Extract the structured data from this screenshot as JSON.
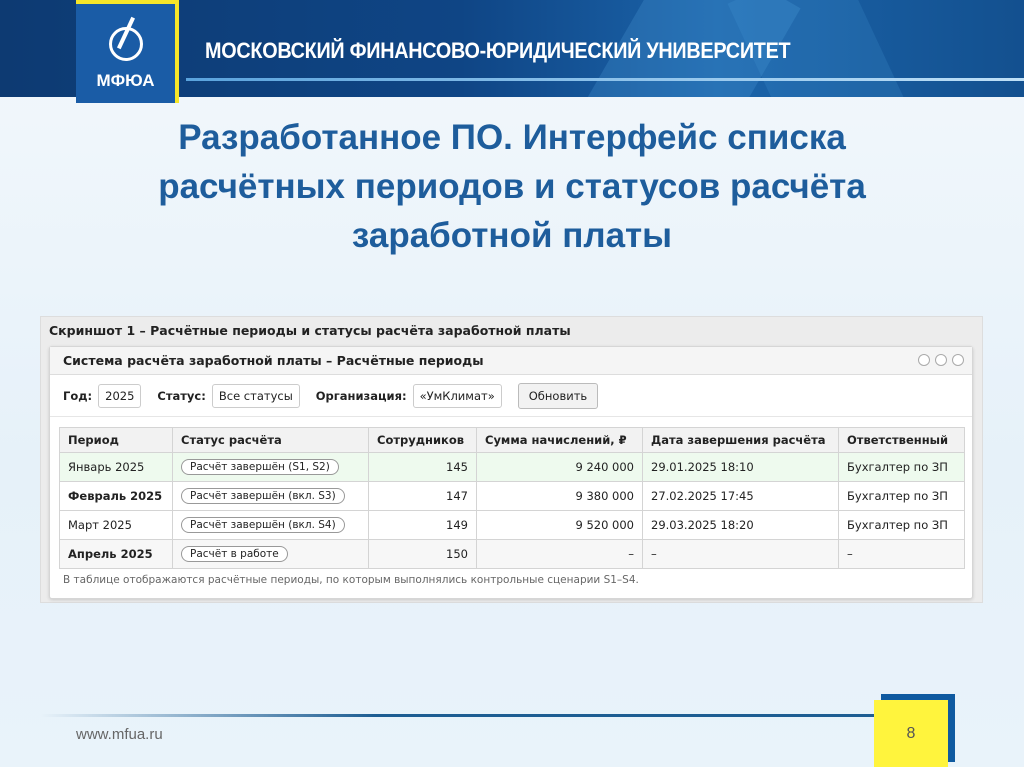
{
  "header": {
    "logo_text": "МФЮА",
    "university": "МОСКОВСКИЙ ФИНАНСОВО-ЮРИДИЧЕСКИЙ УНИВЕРСИТЕТ"
  },
  "slide": {
    "title_lines": [
      "Разработанное ПО. Интерфейс списка",
      "расчётных периодов и статусов расчёта",
      "заработной платы"
    ]
  },
  "screenshot": {
    "caption": "Скриншот 1 – Расчётные периоды и статусы расчёта заработной платы",
    "window_title": "Система расчёта заработной платы – Расчётные периоды",
    "filters": {
      "year_label": "Год:",
      "year_value": "2025",
      "status_label": "Статус:",
      "status_value": "Все статусы",
      "org_label": "Организация:",
      "org_value": "«УмКлимат»",
      "refresh_label": "Обновить"
    },
    "table": {
      "headers": [
        "Период",
        "Статус расчёта",
        "Сотрудников",
        "Сумма начислений, ₽",
        "Дата завершения расчёта",
        "Ответственный"
      ],
      "rows": [
        {
          "period": "Январь 2025",
          "status": "Расчёт завершён (S1, S2)",
          "employees": "145",
          "sum": "9 240 000",
          "date": "29.01.2025 18:10",
          "responsible": "Бухгалтер по ЗП"
        },
        {
          "period": "Февраль 2025",
          "status": "Расчёт завершён (вкл. S3)",
          "employees": "147",
          "sum": "9 380 000",
          "date": "27.02.2025 17:45",
          "responsible": "Бухгалтер по ЗП"
        },
        {
          "period": "Март 2025",
          "status": "Расчёт завершён (вкл. S4)",
          "employees": "149",
          "sum": "9 520 000",
          "date": "29.03.2025 18:20",
          "responsible": "Бухгалтер по ЗП"
        },
        {
          "period": "Апрель 2025",
          "status": "Расчёт в работе",
          "employees": "150",
          "sum": "–",
          "date": "–",
          "responsible": "–"
        }
      ]
    },
    "note": "В таблице отображаются расчётные периоды, по которым выполнялись контрольные сценарии S1–S4."
  },
  "footer": {
    "url": "www.mfua.ru",
    "page": "8"
  }
}
